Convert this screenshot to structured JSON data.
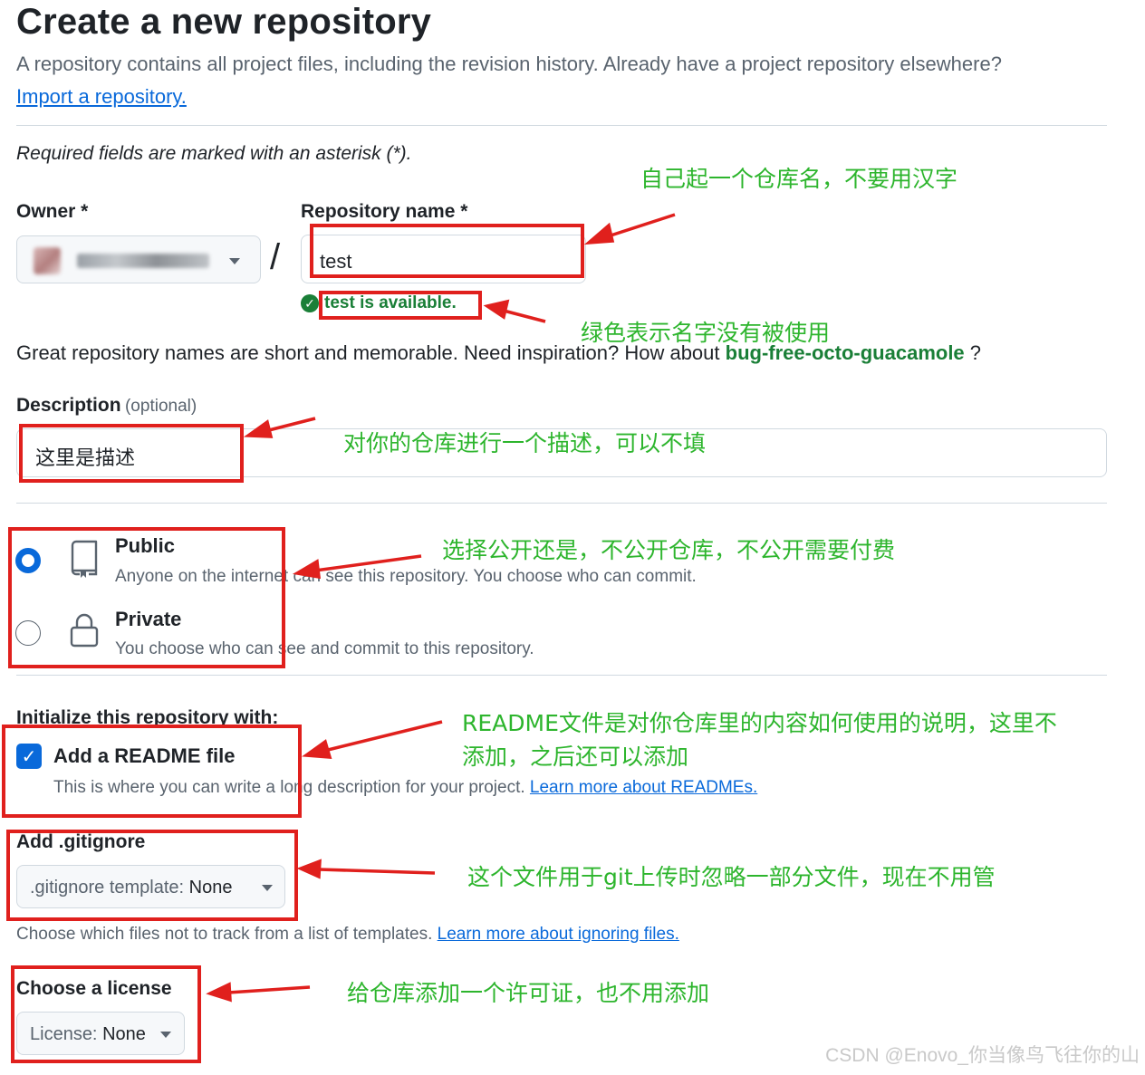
{
  "page": {
    "title": "Create a new repository",
    "subtitle": "A repository contains all project files, including the revision history. Already have a project repository elsewhere?",
    "import_link": "Import a repository.",
    "required_note": "Required fields are marked with an asterisk (*)."
  },
  "owner": {
    "label": "Owner *"
  },
  "repo_name": {
    "label": "Repository name *",
    "value": "test",
    "availability": "test is available."
  },
  "name_hint": {
    "text": "Great repository names are short and memorable. Need inspiration? How about",
    "suggestion": "bug-free-octo-guacamole",
    "end": "?"
  },
  "description": {
    "label": "Description",
    "optional": "(optional)",
    "value": "这里是描述"
  },
  "visibility": {
    "public": {
      "title": "Public",
      "desc": "Anyone on the internet can see this repository. You choose who can commit.",
      "selected": true
    },
    "private": {
      "title": "Private",
      "desc": "You choose who can see and commit to this repository.",
      "selected": false
    }
  },
  "initialize": {
    "heading": "Initialize this repository with:",
    "readme_label": "Add a README file",
    "readme_checked": true,
    "readme_desc": "This is where you can write a long description for your project.",
    "readme_link": "Learn more about READMEs."
  },
  "gitignore": {
    "heading": "Add .gitignore",
    "select_prefix": ".gitignore template:",
    "select_value": "None",
    "help": "Choose which files not to track from a list of templates.",
    "help_link": "Learn more about ignoring files."
  },
  "license": {
    "heading": "Choose a license",
    "select_prefix": "License:",
    "select_value": "None"
  },
  "annotations": {
    "repo_name": "自己起一个仓库名，不要用汉字",
    "available": "绿色表示名字没有被使用",
    "description": "对你的仓库进行一个描述，可以不填",
    "visibility": "选择公开还是，不公开仓库，不公开需要付费",
    "readme_line1": "README文件是对你仓库里的内容如何使用的说明，这里不",
    "readme_line2": "添加，之后还可以添加",
    "gitignore": "这个文件用于git上传时忽略一部分文件，现在不用管",
    "license": "给仓库添加一个许可证，也不用添加"
  },
  "watermark": "CSDN @Enovo_你当像鸟飞往你的山",
  "colors": {
    "accent": "#0969da",
    "success": "#1a7f37",
    "annotation_red": "#e0201d",
    "annotation_green": "#2db52d"
  },
  "icons": [
    "repo-icon",
    "lock-icon",
    "check-circle-icon",
    "checkbox-check-icon",
    "triangle-down-icon"
  ]
}
